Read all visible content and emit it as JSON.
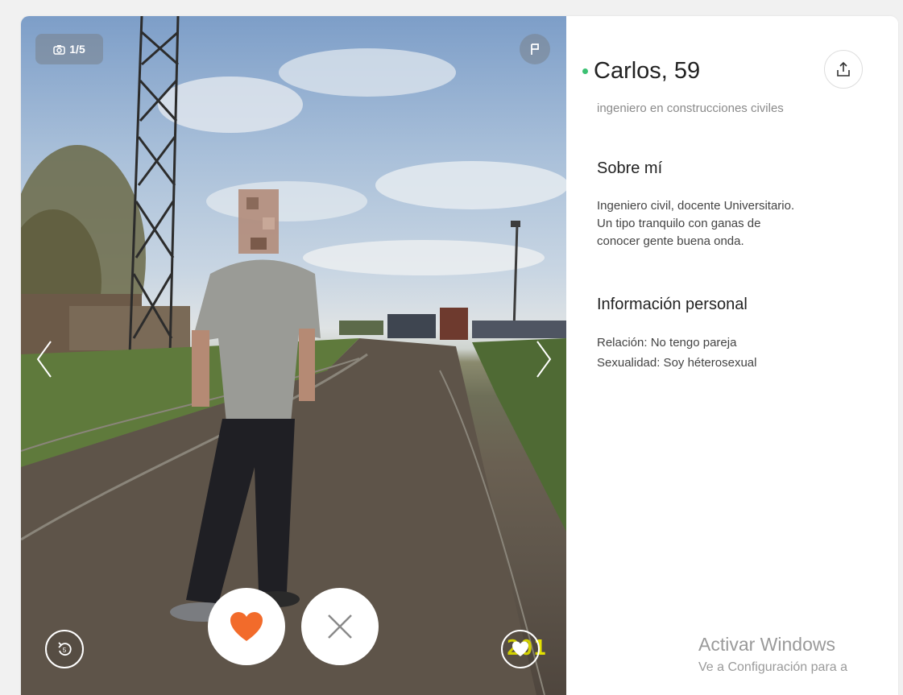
{
  "photo": {
    "counter": "1/5"
  },
  "profile": {
    "name_age": "Carlos, 59",
    "occupation": "ingeniero en construcciones civiles",
    "about_heading": "Sobre mí",
    "about_text": "Ingeniero civil, docente Universitario.\nUn tipo tranquilo con ganas de\nconocer gente buena onda.",
    "info_heading": "Información personal",
    "info": [
      "Relación: No tengo pareja",
      "Sexualidad: Soy héterosexual"
    ]
  },
  "photo_stamp": "201",
  "watermark": {
    "line1": "Activar Windows",
    "line2": "Ve a Configuración para a"
  },
  "colors": {
    "online": "#3cc173",
    "like": "#f26b2b"
  },
  "icons": {
    "camera": "camera-icon",
    "flag": "flag-icon",
    "share": "share-icon",
    "undo": "undo-icon",
    "like": "heart-icon",
    "nope": "close-icon",
    "superlike": "heart-outline-icon"
  }
}
